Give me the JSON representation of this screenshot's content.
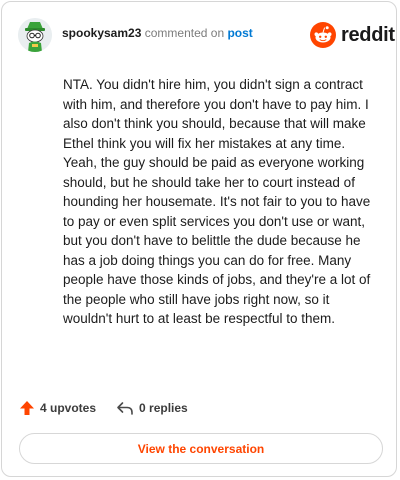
{
  "comment": {
    "username": "spookysam23",
    "action_text": "commented on",
    "link_text": "post",
    "body": "NTA. You didn't hire him, you didn't sign a contract with him, and therefore you don't have to pay him. I also don't think you should, because that will make Ethel think you will fix her mistakes at any time. Yeah, the guy should be paid as everyone working should, but he should take her to court instead of hounding her housemate. It's not fair to you to have to pay or even split services you don't use or want, but you don't have to belittle the dude because he has a job doing things you can do for free. Many people have those kinds of jobs, and they're a lot of the people who still have jobs right now, so it wouldn't hurt to at least be respectful to them."
  },
  "brand": {
    "wordmark": "reddit",
    "accent_color": "#ff4500",
    "icon": "reddit-logo-icon"
  },
  "footer": {
    "upvotes_label": "4 upvotes",
    "replies_label": "0 replies",
    "upvote_icon": "upvote-arrow-icon",
    "reply_icon": "reply-arrow-icon"
  },
  "cta": {
    "label": "View the conversation"
  },
  "colors": {
    "link": "#0079d3",
    "accent": "#ff4500",
    "text": "#1c1c1c",
    "muted": "#7c7c7c"
  }
}
